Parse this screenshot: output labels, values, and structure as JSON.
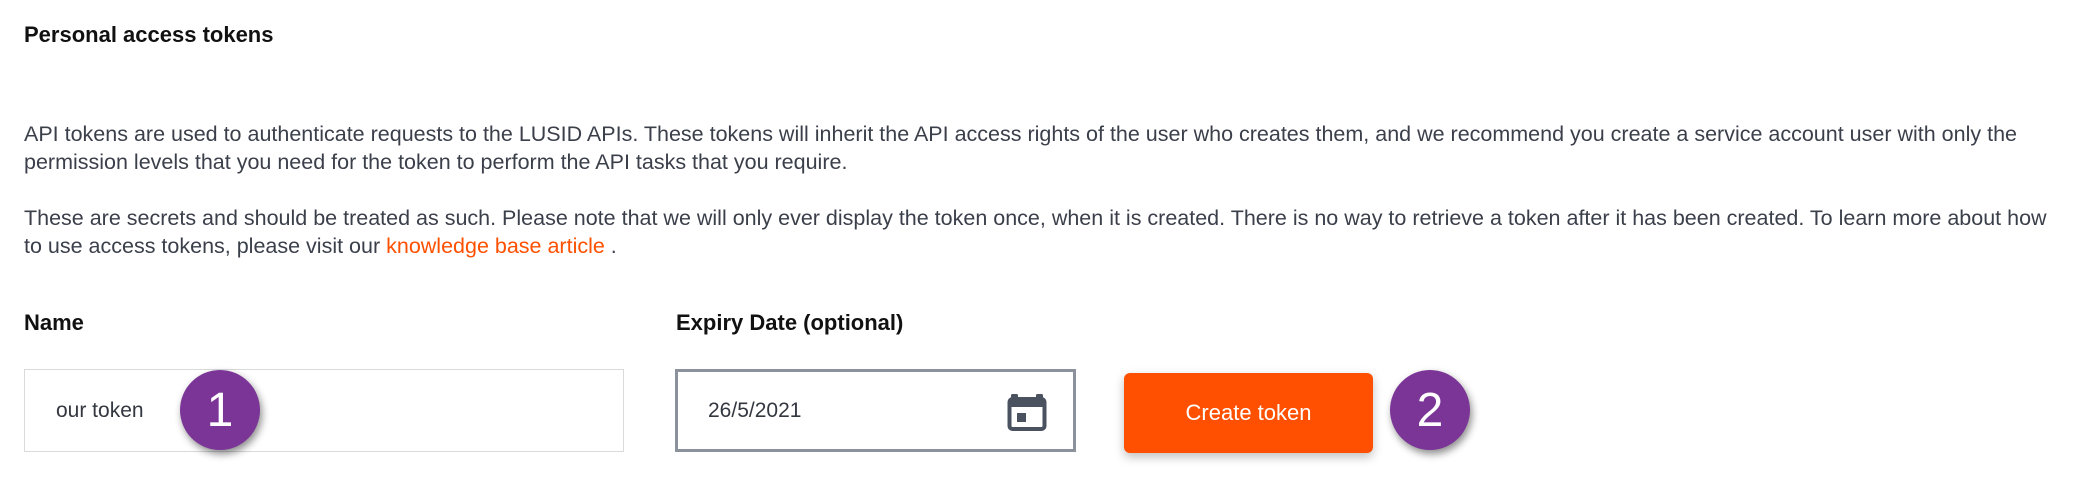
{
  "header": {
    "title": "Personal access tokens"
  },
  "description": {
    "paragraph1": "API tokens are used to authenticate requests to the LUSID APIs. These tokens will inherit the API access rights of the user who creates them, and we recommend you create a service account user with only the permission levels that you need for the token to perform the API tasks that you require.",
    "paragraph2_prefix": "These are secrets and should be treated as such. Please note that we will only ever display the token once, when it is created. There is no way to retrieve a token after it has been created. To learn more about how to use access tokens, please visit our ",
    "link_text": "knowledge base article",
    "paragraph2_suffix": " ."
  },
  "form": {
    "name_label": "Name",
    "name_value": "our token",
    "expiry_label": "Expiry Date (optional)",
    "expiry_value": "26/5/2021",
    "expiry_icon": "calendar-icon",
    "create_button_label": "Create token"
  },
  "annotations": {
    "badge1": "1",
    "badge2": "2"
  },
  "colors": {
    "accent": "#fe5000",
    "badge": "#7b3597",
    "text": "#3a3f4a",
    "heading": "#111111"
  }
}
